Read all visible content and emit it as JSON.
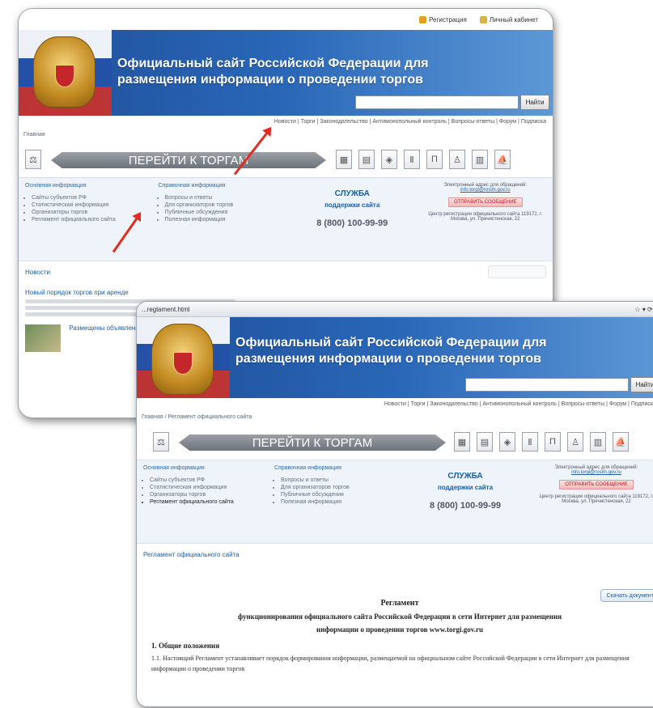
{
  "header": {
    "title": "Официальный сайт Российской Федерации для размещения информации о проведении торгов",
    "search_button": "Найти",
    "register": "Регистрация",
    "personal_cabinet": "Личный кабинет"
  },
  "nav": "Новости | Торги | Законодательство | Антимонопольный контроль | Вопросы-ответы | Форум | Подписка",
  "goto_label": "ПЕРЕЙТИ К ТОРГАМ",
  "icons": [
    "building-icon",
    "document-icon",
    "map-icon",
    "monument-icon",
    "column-icon",
    "person-icon",
    "factory-icon",
    "ship-icon"
  ],
  "info": {
    "main_title": "Основная информация",
    "main_items": [
      "Сайты субъектов РФ",
      "Статистическая информация",
      "Организаторы торгов",
      "Регламент официального сайта"
    ],
    "ref_title": "Справочная информация",
    "ref_items": [
      "Вопросы и ответы",
      "Для организаторов торгов",
      "Публичные обсуждения",
      "Полезная информация"
    ],
    "service_t1": "СЛУЖБА",
    "service_t2": "поддержки сайта",
    "phone": "8 (800) 100-99-99",
    "fb_line1": "Электронный адрес для обращений:",
    "fb_mail": "info.torgi@rosim.gov.ru",
    "fb_button": "ОТПРАВИТЬ СООБЩЕНИЕ",
    "fb_address": "Центр регистрации официального сайта 119172, г. Москва, ул. Пречистенская, 22"
  },
  "shot1": {
    "crumb": "Главная",
    "link": "Новости",
    "news_title": "Новый порядок торгов при аренде",
    "news_sub": "Размещены объявления о торгах"
  },
  "shot2": {
    "url": "...reglament.html",
    "crumb": "Главная / Регламент официального сайта",
    "link": "Регламент официального сайта",
    "download": "Скачать документ",
    "doc_title": "Регламент",
    "doc_sub1": "функционирования официального сайта Российской Федерации в сети Интернет для размещения",
    "doc_sub2": "информации о проведении торгов www.torgi.gov.ru",
    "section": "1.   Общие положения",
    "para": "1.1.   Настоящий Регламент устанавливает порядок формирования информации, размещаемой на официальном сайте Российской Федерации в сети Интернет для размещения информации о проведении торгов"
  },
  "colors": {
    "arrow": "#e22b20",
    "banner": "#2a67b8",
    "link": "#1b5fa3"
  }
}
